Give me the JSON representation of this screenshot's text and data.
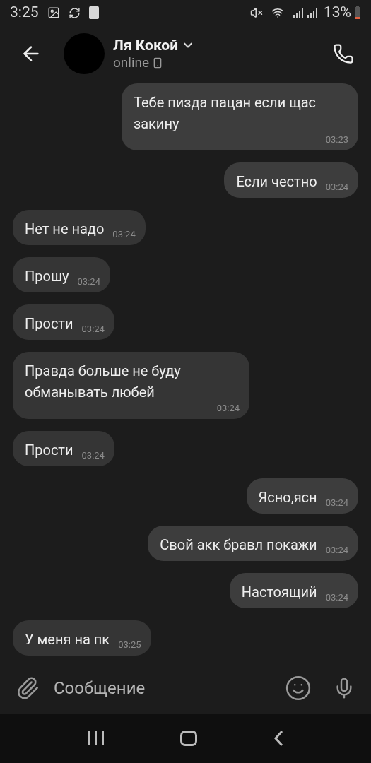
{
  "status_bar": {
    "time": "3:25",
    "battery": "13%"
  },
  "header": {
    "name": "Ля Кокой",
    "status": "online"
  },
  "messages": [
    {
      "kind": "out",
      "text": "Тебе пизда пацан если щас закину",
      "time": "03:23"
    },
    {
      "kind": "out",
      "text": "Если честно",
      "time": "03:24"
    },
    {
      "kind": "in",
      "text": "Нет не надо",
      "time": "03:24"
    },
    {
      "kind": "in",
      "text": "Прошу",
      "time": "03:24"
    },
    {
      "kind": "in",
      "text": "Прости",
      "time": "03:24"
    },
    {
      "kind": "in",
      "text": "Правда больше не буду обманывать любей",
      "time": "03:24"
    },
    {
      "kind": "in",
      "text": "Прости",
      "time": "03:24"
    },
    {
      "kind": "out",
      "text": "Ясно,ясн",
      "time": "03:24"
    },
    {
      "kind": "out",
      "text": "Свой акк бравл покажи",
      "time": "03:24"
    },
    {
      "kind": "out",
      "text": "Настоящий",
      "time": "03:24"
    },
    {
      "kind": "in",
      "text": "У меня на пк",
      "time": "03:25"
    }
  ],
  "composer": {
    "placeholder": "Сообщение"
  }
}
